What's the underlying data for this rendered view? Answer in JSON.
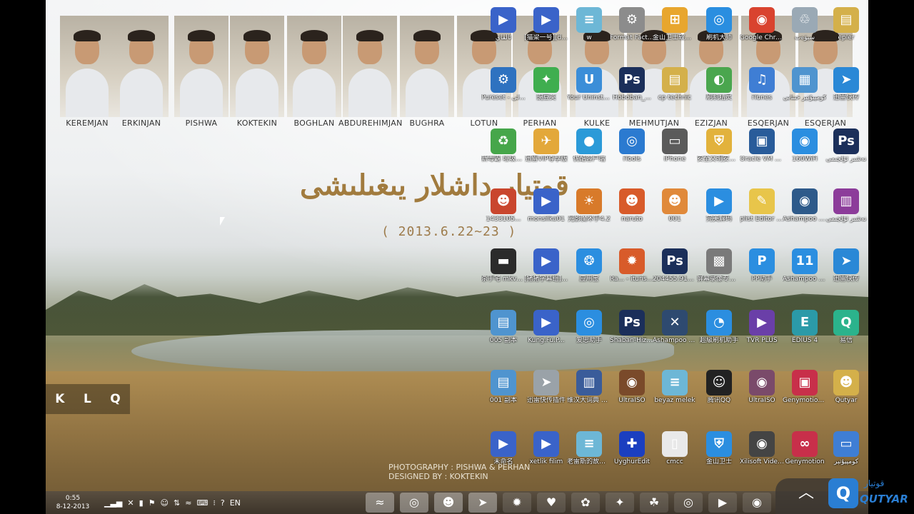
{
  "wallpaper": {
    "people": [
      "KEREMJAN",
      "ERKINJAN",
      "PISHWA",
      "KOKTEKIN",
      "BOGHLAN",
      "ABDUREHIMJAN",
      "BUGHRA",
      "LOTUN",
      "PERHAN",
      "KULKE",
      "MEHMUTJAN",
      "EZIZJAN",
      "ESQERJAN",
      "ESQERJAN"
    ],
    "title": "قوتيار داشلار يىغىلىشى",
    "date": "( 2013.6.22~23 )",
    "credit_photo": "PHOTOGRAPHY : PISHWA & PERHAN",
    "credit_design": "DESIGNED BY : KOKTEKIN",
    "klq": [
      "K",
      "L",
      "Q"
    ]
  },
  "desktop_icons": [
    {
      "label": "ئالقاي",
      "glyph": "▶",
      "color": "#3a63c9",
      "icon": "mkv-icon"
    },
    {
      "label": "[猫梁一号][dmhy][e...",
      "glyph": "▶",
      "color": "#3a63c9",
      "icon": "mkv-icon"
    },
    {
      "label": "w",
      "glyph": "≡",
      "color": "#6db7d6",
      "icon": "notepad-icon"
    },
    {
      "label": "Format Factory",
      "glyph": "⚙",
      "color": "#8c8c8c",
      "icon": "format-factory-icon"
    },
    {
      "label": "金山卫士软件管理",
      "glyph": "⊞",
      "color": "#e8a62e",
      "icon": "software-manager-icon"
    },
    {
      "label": "刷机大师",
      "glyph": "◎",
      "color": "#2a8ee0",
      "icon": "flash-master-icon"
    },
    {
      "label": "Google Chrome",
      "glyph": "◉",
      "color": "#d9432f",
      "icon": "chrome-icon"
    },
    {
      "label": "سېۋەت",
      "glyph": "♲",
      "color": "#9aa9b5",
      "icon": "recycle-bin-icon"
    },
    {
      "label": "epler",
      "glyph": "▤",
      "color": "#d4b04a",
      "icon": "folder-icon"
    },
    {
      "label": "Pureset - تەستىق ئولى",
      "glyph": "⚙",
      "color": "#2e72c0",
      "icon": "gear-icon"
    },
    {
      "label": "豌豆荚",
      "glyph": "✦",
      "color": "#3fae4f",
      "icon": "wandoujia-icon"
    },
    {
      "label": "Your Uninstaller!",
      "glyph": "U",
      "color": "#3b8ed8",
      "icon": "uninstaller-icon"
    },
    {
      "label": "Hoboban_...",
      "glyph": "Ps",
      "color": "#1b2f5a",
      "icon": "photoshop-icon"
    },
    {
      "label": "cp technic",
      "glyph": "▤",
      "color": "#d4b04a",
      "icon": "folder-icon"
    },
    {
      "label": "刷机精灵",
      "glyph": "◐",
      "color": "#4aa64e",
      "icon": "flash-elf-icon"
    },
    {
      "label": "iTunes",
      "glyph": "♫",
      "color": "#3f7ed4",
      "icon": "itunes-icon"
    },
    {
      "label": "كومپيۇتېر خىتابى",
      "glyph": "▦",
      "color": "#4f94cf",
      "icon": "computer-icon"
    },
    {
      "label": "迅雷快传",
      "glyph": "➤",
      "color": "#2a88d6",
      "icon": "xunlei-icon"
    },
    {
      "label": "新毒霸 垃圾清理",
      "glyph": "♻",
      "color": "#46a64a",
      "icon": "cleaner-icon"
    },
    {
      "label": "迅雷VIP尊享版",
      "glyph": "✈",
      "color": "#e3a83a",
      "icon": "xunlei-vip-icon"
    },
    {
      "label": "优酷客户端",
      "glyph": "●",
      "color": "#2b9ad8",
      "icon": "youku-icon"
    },
    {
      "label": "iTools",
      "glyph": "◎",
      "color": "#2b7ad0",
      "icon": "itools-icon"
    },
    {
      "label": "iPhone",
      "glyph": "▭",
      "color": "#5b5b5b",
      "icon": "iphone-icon"
    },
    {
      "label": "安全文明安装新手专用",
      "glyph": "⛨",
      "color": "#e2b23c",
      "icon": "shield-icon"
    },
    {
      "label": "Oracle VM VirtualBox",
      "glyph": "▣",
      "color": "#295c9a",
      "icon": "virtualbox-icon"
    },
    {
      "label": "160WiFi",
      "glyph": "◉",
      "color": "#2b8ee0",
      "icon": "wifi-icon"
    },
    {
      "label": "نەشىر ئۆلچىمى",
      "glyph": "Ps",
      "color": "#1b2f5a",
      "icon": "photoshop-icon"
    },
    {
      "label": "1433105...",
      "glyph": "☻",
      "color": "#c9462e",
      "icon": "image-icon"
    },
    {
      "label": "monsilka01",
      "glyph": "▶",
      "color": "#3a63c9",
      "icon": "mkv-icon"
    },
    {
      "label": "光影魔术手4.2",
      "glyph": "☀",
      "color": "#d87a2a",
      "icon": "photo-editor-icon"
    },
    {
      "label": "naruto",
      "glyph": "☻",
      "color": "#d85b2a",
      "icon": "naruto-icon"
    },
    {
      "label": "001",
      "glyph": "☻",
      "color": "#e0893a",
      "icon": "image-icon"
    },
    {
      "label": "完美解码",
      "glyph": "▶",
      "color": "#2b8ee0",
      "icon": "player-icon"
    },
    {
      "label": "plist Editor for Windows",
      "glyph": "✎",
      "color": "#e8c54a",
      "icon": "plist-editor-icon"
    },
    {
      "label": "Ashampoo Burning ...",
      "glyph": "◉",
      "color": "#2e5a8a",
      "icon": "ashampoo-icon"
    },
    {
      "label": "نەشىر ئۆلچىمى",
      "glyph": "▥",
      "color": "#8c3c9a",
      "icon": "archive-icon"
    },
    {
      "label": "杀手宅 mkv_snap...",
      "glyph": "▬",
      "color": "#2b2b2b",
      "icon": "video-thumbnail-icon"
    },
    {
      "label": "[猪猪字幕组][招牌...",
      "glyph": "▶",
      "color": "#3a63c9",
      "icon": "mkv-icon"
    },
    {
      "label": "应用宝",
      "glyph": "❂",
      "color": "#2b8ee0",
      "icon": "app-store-icon"
    },
    {
      "label": "Ra... - iturist ئويۇنلار",
      "glyph": "✹",
      "color": "#d85b2a",
      "icon": "game-icon"
    },
    {
      "label": "204455.918...",
      "glyph": "Ps",
      "color": "#1b2f5a",
      "icon": "photoshop-icon"
    },
    {
      "label": "屏幕录像专家V2012",
      "glyph": "▩",
      "color": "#7a7a7a",
      "icon": "screen-recorder-icon"
    },
    {
      "label": "PP助手",
      "glyph": "P",
      "color": "#2b8ee0",
      "icon": "pp-assistant-icon"
    },
    {
      "label": "Ashampoo Burning ...",
      "glyph": "11",
      "color": "#2b8ee0",
      "icon": "ashampoo-icon"
    },
    {
      "label": "迅雷快传",
      "glyph": "➤",
      "color": "#2a88d6",
      "icon": "xunlei-icon"
    },
    {
      "label": "005 副本",
      "glyph": "▤",
      "color": "#4f94cf",
      "icon": "document-icon"
    },
    {
      "label": "Kung.Fu.P...",
      "glyph": "▶",
      "color": "#3a63c9",
      "icon": "real-video-icon"
    },
    {
      "label": "爱思助手",
      "glyph": "◎",
      "color": "#2b8ee0",
      "icon": "i4-assistant-icon"
    },
    {
      "label": "Shaban-Hiz sinipi",
      "glyph": "Ps",
      "color": "#1b2f5a",
      "icon": "photoshop-icon"
    },
    {
      "label": "Ashampoo Burning ...",
      "glyph": "✕",
      "color": "#2e4a70",
      "icon": "ashampoo-icon"
    },
    {
      "label": "超級刷机助手",
      "glyph": "◔",
      "color": "#2b8ee0",
      "icon": "flash-assistant-icon"
    },
    {
      "label": "TVR PLUS",
      "glyph": "▶",
      "color": "#6a3fa8",
      "icon": "tvr-icon"
    },
    {
      "label": "EDIUS 4",
      "glyph": "E",
      "color": "#2b9aa8",
      "icon": "edius-icon"
    },
    {
      "label": "易信",
      "glyph": "Q",
      "color": "#2bb38c",
      "icon": "yixin-icon"
    },
    {
      "label": "001 副本",
      "glyph": "▤",
      "color": "#4f94cf",
      "icon": "document-icon"
    },
    {
      "label": "迅雷快传插件",
      "glyph": "➤",
      "color": "#9aa2a8",
      "icon": "xunlei-plugin-icon"
    },
    {
      "label": "维汉大词典 2007",
      "glyph": "▥",
      "color": "#3a5c9a",
      "icon": "dictionary-icon"
    },
    {
      "label": "UltraISO",
      "glyph": "◉",
      "color": "#7a4a2a",
      "icon": "ultraiso-icon"
    },
    {
      "label": "beyaz melek",
      "glyph": "≡",
      "color": "#6db7d6",
      "icon": "notepad-icon"
    },
    {
      "label": "腾讯QQ",
      "glyph": "☺",
      "color": "#222",
      "icon": "qq-icon"
    },
    {
      "label": "UltraISO",
      "glyph": "◉",
      "color": "#7a4a6a",
      "icon": "ultraiso-icon"
    },
    {
      "label": "Genymotion Shell",
      "glyph": "▣",
      "color": "#c82f4a",
      "icon": "genymotion-shell-icon"
    },
    {
      "label": "Qutyar",
      "glyph": "☻",
      "color": "#d4b04a",
      "icon": "user-folder-icon"
    },
    {
      "label": "未命名",
      "glyph": "▶",
      "color": "#3a63c9",
      "icon": "flv-icon"
    },
    {
      "label": "xetlik filim",
      "glyph": "▶",
      "color": "#3a63c9",
      "icon": "flv-icon"
    },
    {
      "label": "老雷斯的故事DVD1",
      "glyph": "≡",
      "color": "#6db7d6",
      "icon": "notepad-icon"
    },
    {
      "label": "UyghurEdit",
      "glyph": "✚",
      "color": "#1b3fc0",
      "icon": "uyghuredit-icon"
    },
    {
      "label": "cmcc",
      "glyph": "▯",
      "color": "#e9e9e9",
      "icon": "blank-document-icon"
    },
    {
      "label": "金山卫士",
      "glyph": "⛨",
      "color": "#2b8ee0",
      "icon": "shield-icon"
    },
    {
      "label": "Xilisoft Video Converter ...",
      "glyph": "◉",
      "color": "#444",
      "icon": "video-converter-icon"
    },
    {
      "label": "Genymotion",
      "glyph": "∞",
      "color": "#c82f4a",
      "icon": "genymotion-icon"
    },
    {
      "label": "كومپيۇتېر",
      "glyph": "▭",
      "color": "#3f7ed4",
      "icon": "my-computer-icon"
    }
  ],
  "taskbar": {
    "time": "0:55",
    "date": "8-12-2013",
    "language": "EN",
    "tray": [
      "▁▃▅",
      "✕",
      "▮",
      "⚑",
      "☺",
      "⇅",
      "≈",
      "⌨",
      "⁝",
      "?"
    ],
    "tasks": [
      "≈",
      "◎",
      "☻",
      "➤",
      "✹",
      "♥",
      "✿",
      "✦",
      "☘",
      "◎",
      "▶",
      "◉"
    ]
  },
  "logo": {
    "word": "QUTYAR",
    "script": "قوتيار"
  }
}
